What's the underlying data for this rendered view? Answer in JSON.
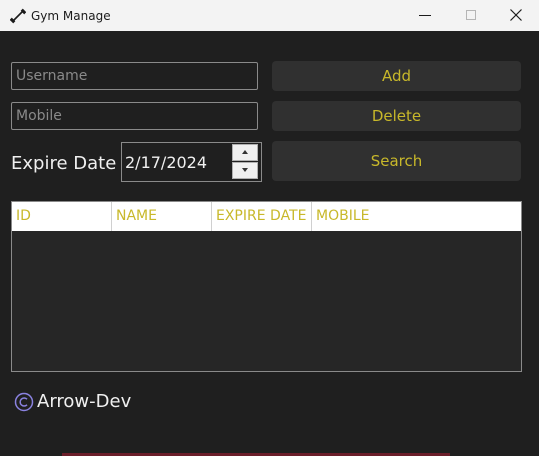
{
  "window": {
    "title": "Gym Manage"
  },
  "form": {
    "username_placeholder": "Username",
    "mobile_placeholder": "Mobile",
    "expire_label": "Expire Date",
    "expire_value": "2/17/2024"
  },
  "buttons": {
    "add": "Add",
    "delete": "Delete",
    "search": "Search"
  },
  "table": {
    "columns": [
      "ID",
      "NAME",
      "EXPIRE DATE",
      "MOBILE"
    ],
    "rows": []
  },
  "footer": {
    "brand": "Arrow-Dev"
  },
  "colors": {
    "accent": "#c8b82a",
    "background": "#1f1f1f",
    "button": "#303030"
  },
  "icons": {
    "app": "dumbbell-icon",
    "copyright": "copyright-icon"
  }
}
